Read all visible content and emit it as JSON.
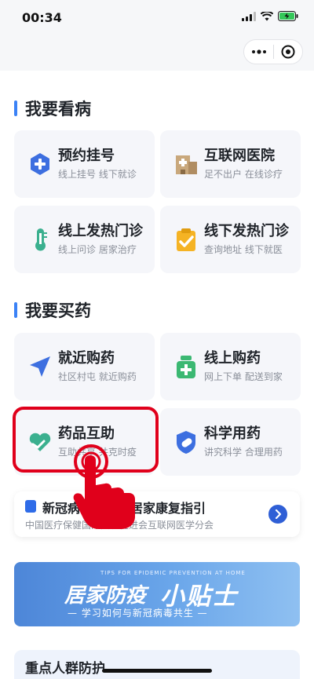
{
  "status": {
    "time": "00:34"
  },
  "sections": {
    "see_doctor": {
      "title": "我要看病"
    },
    "buy_medicine": {
      "title": "我要买药"
    }
  },
  "cards": {
    "appointment": {
      "title": "预约挂号",
      "sub": "线上挂号 线下就诊",
      "icon": "plus-shield-icon"
    },
    "internet_hospital": {
      "title": "互联网医院",
      "sub": "足不出户 在线诊疗",
      "icon": "hospital-building-icon"
    },
    "online_fever": {
      "title": "线上发热门诊",
      "sub": "线上问诊 居家治疗",
      "icon": "thermometer-icon"
    },
    "offline_fever": {
      "title": "线下发热门诊",
      "sub": "查询地址 线下就医",
      "icon": "clipboard-check-icon"
    },
    "nearby_buy": {
      "title": "就近购药",
      "sub": "社区村屯 就近购药",
      "icon": "location-arrow-icon"
    },
    "online_buy": {
      "title": "线上购药",
      "sub": "网上下单 配送到家",
      "icon": "medicine-bottle-icon"
    },
    "medicine_mutual": {
      "title": "药品互助",
      "sub": "互助共享 共克时疫",
      "icon": "heart-hands-icon"
    },
    "scientific_use": {
      "title": "科学用药",
      "sub": "讲究科学 合理用药",
      "icon": "pill-shield-icon"
    }
  },
  "notice": {
    "title": "新冠病毒感染者居家康复指引",
    "sub": "中国医疗保健国际交流促进会互联网医学分会"
  },
  "banner": {
    "tag": "TIPS FOR EPIDEMIC PREVENTION AT HOME",
    "title_left": "居家防疫",
    "title_right": "小贴士",
    "subtitle": "— 学习如何与新冠病毒共生 —"
  },
  "bottom": {
    "title": "重点人群防护"
  },
  "colors": {
    "accent": "#3b82f6",
    "highlight": "#e0001b",
    "card_bg": "#f5f6fa"
  }
}
